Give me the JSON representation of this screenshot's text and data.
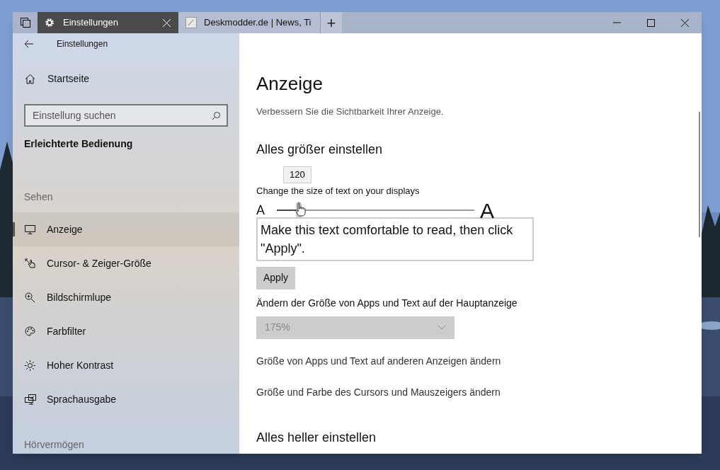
{
  "tabs": [
    {
      "label": "Einstellungen",
      "selected": true,
      "kind": "settings"
    },
    {
      "label": "Deskmodder.de | News, Ti",
      "selected": false,
      "kind": "web"
    }
  ],
  "new_tab": "+",
  "sidebar": {
    "title": "Einstellungen",
    "home": "Startseite",
    "search": {
      "placeholder": "Einstellung suchen"
    },
    "category": "Erleichterte Bedienung",
    "groups": [
      {
        "heading": "Sehen",
        "items": [
          {
            "label": "Anzeige",
            "selected": true
          },
          {
            "label": "Cursor- & Zeiger-Größe",
            "selected": false
          },
          {
            "label": "Bildschirmlupe",
            "selected": false
          },
          {
            "label": "Farbfilter",
            "selected": false
          },
          {
            "label": "Hoher Kontrast",
            "selected": false
          },
          {
            "label": "Sprachausgabe",
            "selected": false
          }
        ]
      },
      {
        "heading": "Hörvermögen"
      }
    ]
  },
  "content": {
    "title": "Anzeige",
    "subtitle": "Verbessern Sie die Sichtbarkeit Ihrer Anzeige.",
    "section1": "Alles größer einstellen",
    "slider": {
      "label": "Change the size of text on your displays",
      "tooltip": "120",
      "small": "A",
      "large": "A",
      "level": 0.11
    },
    "sample": "Make this text comfortable to read, then click \"Apply\".",
    "apply": "Apply",
    "scale_label": "Ändern der Größe von Apps und Text auf der Hauptanzeige",
    "scale_dropdown": {
      "value": "175%",
      "disabled": true
    },
    "links": [
      "Größe von Apps und Text auf anderen Anzeigen ändern",
      "Größe und Farbe des Cursors und Mauszeigers ändern"
    ],
    "section2": "Alles heller einstellen"
  }
}
